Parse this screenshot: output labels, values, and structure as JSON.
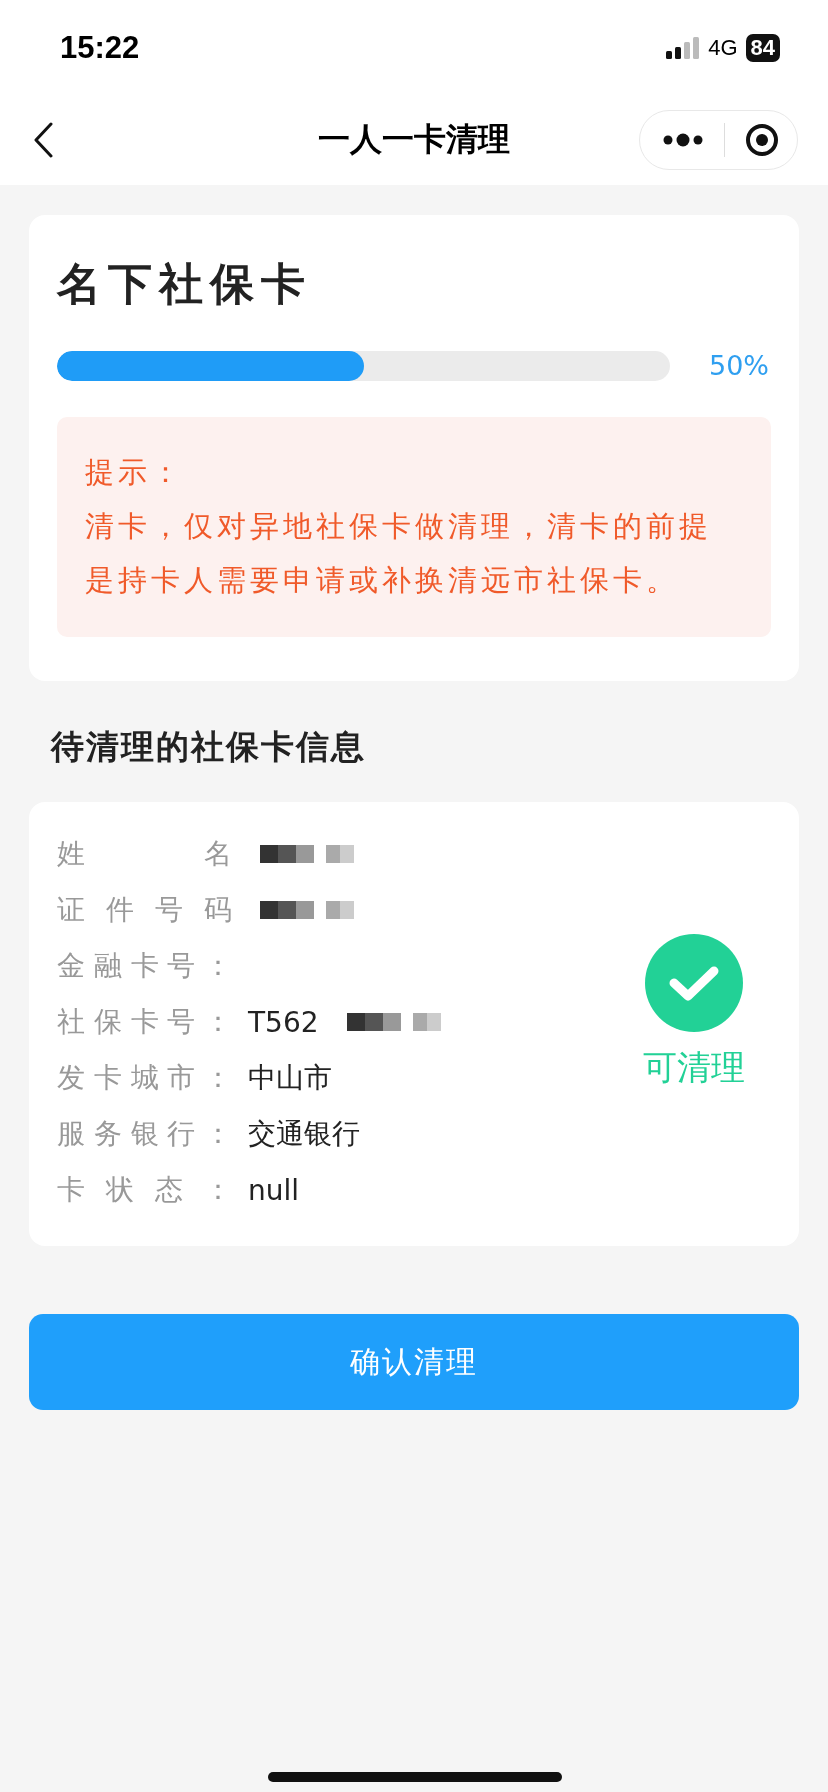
{
  "status_bar": {
    "time": "15:22",
    "network": "4G",
    "battery": "84"
  },
  "nav": {
    "title": "一人一卡清理"
  },
  "summary_card": {
    "title": "名下社保卡",
    "progress": {
      "level": 0.5,
      "reading": "50%"
    },
    "notice": {
      "heading": "提示：",
      "text": "清卡，仅对异地社保卡做清理，清卡的前提是持卡人需要申请或补换清远市社保卡。"
    }
  },
  "section_title": "待清理的社保卡信息",
  "info_card": {
    "fields": [
      {
        "label": "姓名",
        "redacted": true
      },
      {
        "label": "证件号码",
        "redacted": true
      },
      {
        "label": "金融卡号：",
        "redacted": false
      },
      {
        "label": "社保卡号：",
        "value": "T562",
        "redacted": true
      },
      {
        "label": "发卡城市：",
        "value": "中山市",
        "redacted": false
      },
      {
        "label": "服务银行：",
        "value": "交通银行",
        "redacted": false
      },
      {
        "label": "卡状态：",
        "value": "null",
        "redacted": false
      }
    ],
    "status": {
      "kind": "ok",
      "label": "可清理"
    }
  },
  "confirm_button": "确认清理"
}
